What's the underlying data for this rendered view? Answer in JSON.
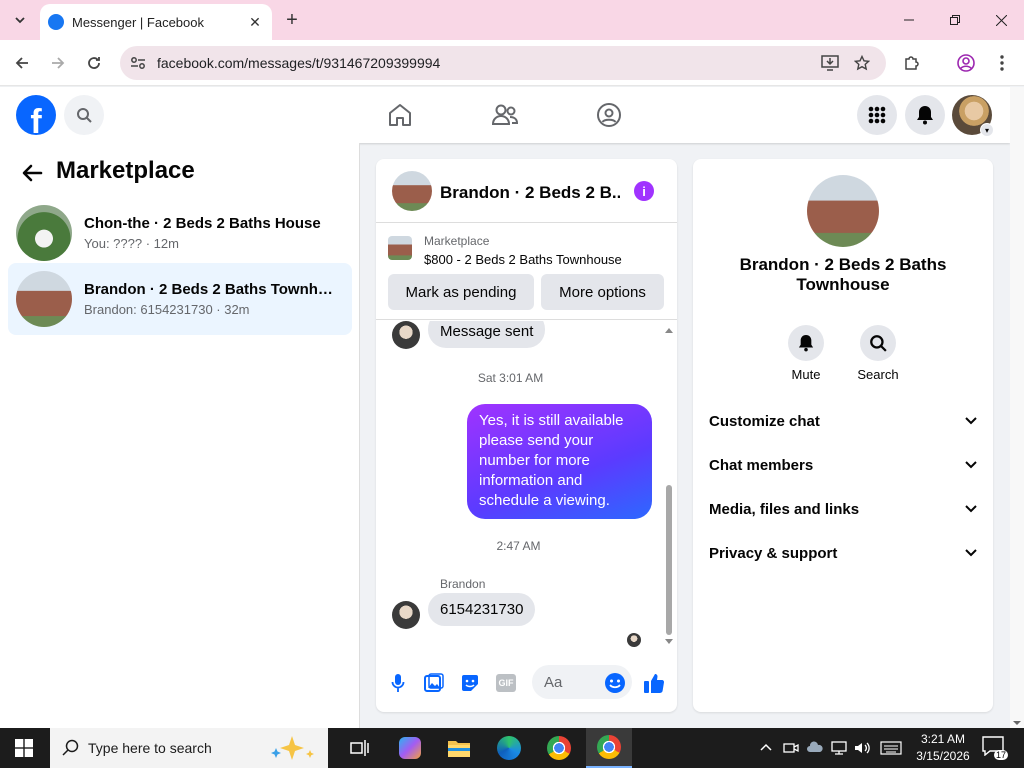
{
  "browser": {
    "tab_title": "Messenger | Facebook",
    "url": "facebook.com/messages/t/931467209399994"
  },
  "header": {
    "logo_letter": "f"
  },
  "left": {
    "title": "Marketplace",
    "conversations": [
      {
        "name": "Chon-the · 2 Beds 2 Baths House",
        "preview": "You: ???? · 12m"
      },
      {
        "name": "Brandon · 2 Beds 2 Baths Townhou...",
        "preview": "Brandon: 6154231730 · 32m"
      }
    ]
  },
  "chat": {
    "title": "Brandon · 2 Beds 2 B...",
    "info_glyph": "i",
    "listing_label": "Marketplace",
    "listing_title": "$800 - 2 Beds 2 Baths Townhouse",
    "mark_pending": "Mark as pending",
    "more_options": "More options",
    "messages": {
      "sent_notice": "Message sent",
      "time1": "Sat 3:01 AM",
      "outgoing": "Yes, it is still available please send your number for more information and schedule a viewing.",
      "time2": "2:47 AM",
      "sender": "Brandon",
      "incoming": "6154231730"
    },
    "composer_placeholder": "Aa",
    "gif_label": "GIF"
  },
  "right": {
    "name": "Brandon · 2 Beds 2 Baths Townhouse",
    "mute": "Mute",
    "search": "Search",
    "sections": [
      "Customize chat",
      "Chat members",
      "Media, files and links",
      "Privacy & support"
    ]
  },
  "taskbar": {
    "search_placeholder": "Type here to search",
    "time": "3:21 AM",
    "date": "3/15/2026",
    "notif_count": "17"
  },
  "colors": {
    "fb_blue": "#0866ff",
    "messenger_purple": "#a033ff",
    "titlebar_pink": "#f9d7e6"
  }
}
